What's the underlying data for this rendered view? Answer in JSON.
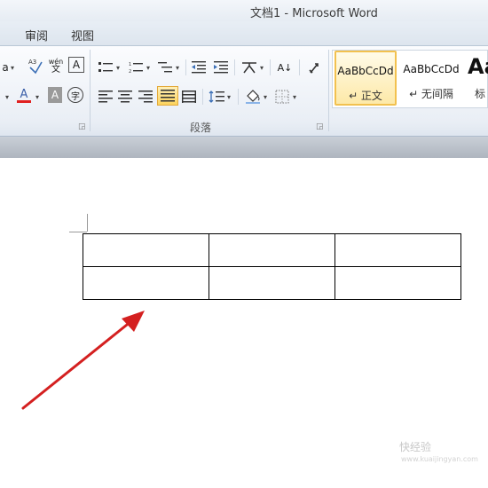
{
  "window": {
    "title": "文档1  -  Microsoft Word"
  },
  "tabs": [
    {
      "label": "审阅"
    },
    {
      "label": "视图"
    }
  ],
  "ribbon": {
    "font_group": {
      "clear_format_glyph": "a",
      "phonetic_glyph": "wén",
      "border_char_glyph": "A",
      "font_color_glyph": "A",
      "font_color": "#e02020",
      "char_shading_glyph": "A",
      "enclose_char_glyph": "字"
    },
    "paragraph_group": {
      "label": "段落",
      "sort_glyph": "A↓"
    },
    "styles_group": {
      "styles": [
        {
          "sample": "AaBbCcDd",
          "name": "↵ 正文",
          "active": true
        },
        {
          "sample": "AaBbCcDd",
          "name": "↵ 无间隔",
          "active": false
        },
        {
          "sample": "Aa",
          "name": "标",
          "active": false
        }
      ]
    }
  },
  "document": {
    "table": {
      "rows": 2,
      "cols": 3
    }
  },
  "annotation": {
    "arrow_color": "#d42020"
  },
  "watermark": {
    "text": "快经验",
    "subtext": "www.kuaijingyan.com"
  }
}
